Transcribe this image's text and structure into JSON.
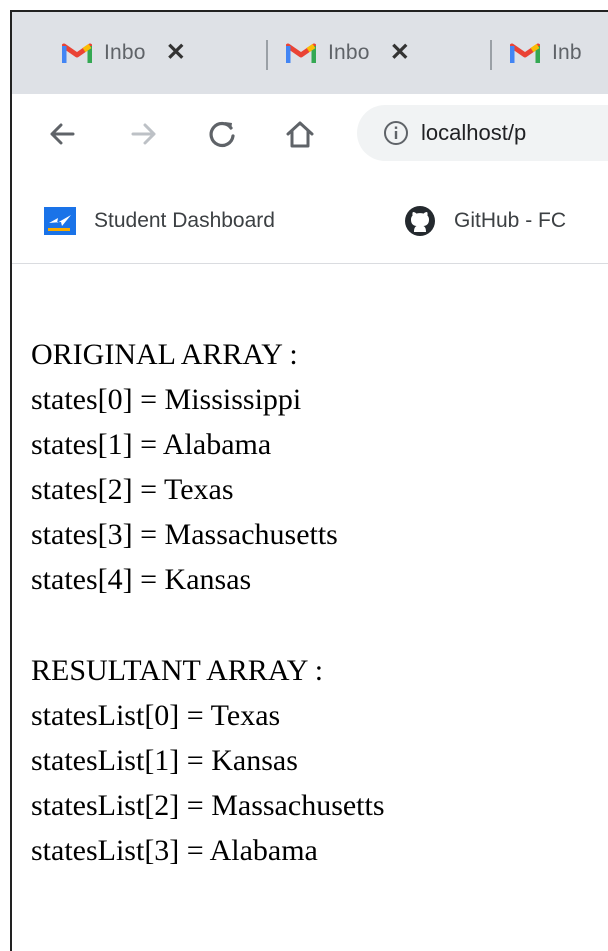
{
  "browser": {
    "tabs": [
      {
        "title": "Inbo",
        "icon": "gmail-icon"
      },
      {
        "title": "Inbo",
        "icon": "gmail-icon"
      },
      {
        "title": "Inb",
        "icon": "gmail-icon"
      }
    ],
    "close_glyph": "✕",
    "address_bar": {
      "url": "localhost/p",
      "icon": "info-icon"
    },
    "bookmarks": [
      {
        "label": "Student Dashboard",
        "icon": "student-dashboard-icon"
      },
      {
        "label": "GitHub - FC",
        "icon": "github-icon"
      }
    ]
  },
  "page": {
    "original_heading": "ORIGINAL ARRAY :",
    "original_items": [
      "states[0] = Mississippi",
      "states[1] = Alabama",
      "states[2] = Texas",
      "states[3] = Massachusetts",
      "states[4] = Kansas"
    ],
    "resultant_heading": "RESULTANT ARRAY :",
    "resultant_items": [
      "statesList[0] = Texas",
      "statesList[1] = Kansas",
      "statesList[2] = Massachusetts",
      "statesList[3] = Alabama"
    ]
  },
  "colors": {
    "tabstrip": "#dee1e6",
    "omnibox": "#f1f3f4",
    "gmail_red": "#ea4335",
    "gmail_blue": "#4285f4",
    "gmail_green": "#34a853",
    "gmail_yellow": "#fbbc04"
  }
}
